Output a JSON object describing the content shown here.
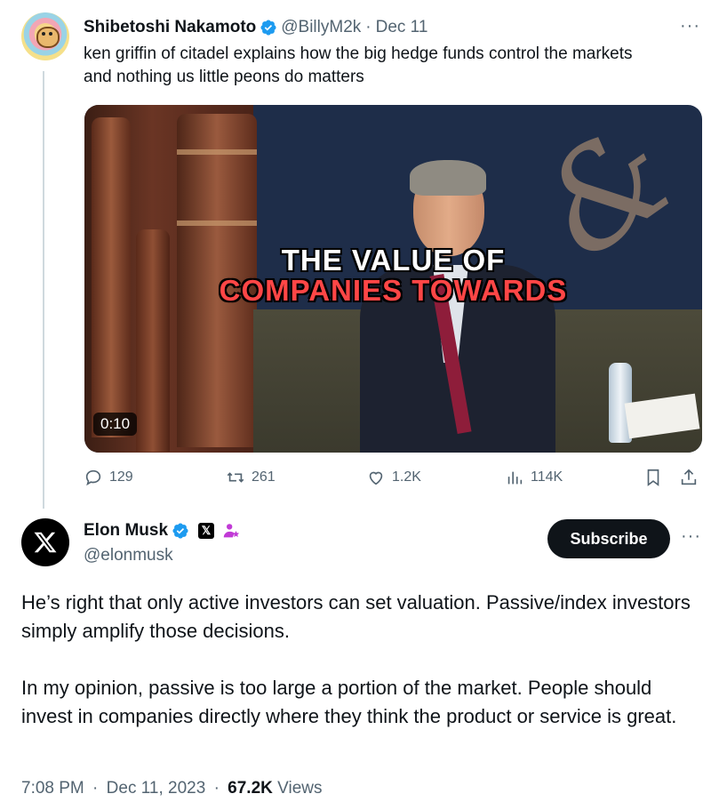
{
  "quoted_tweet": {
    "author_name": "Shibetoshi Nakamoto",
    "handle": "@BillyM2k",
    "separator": "·",
    "date": "Dec 11",
    "more": "···",
    "text_line1": "ken griffin of citadel explains how the big hedge funds control the markets",
    "text_line2": "and nothing us little peons do matters",
    "video": {
      "caption_line1": "THE VALUE OF",
      "caption_line2": "COMPANIES TOWARDS",
      "duration": "0:10"
    },
    "actions": {
      "replies": "129",
      "reposts": "261",
      "likes": "1.2K",
      "views": "114K"
    }
  },
  "main_tweet": {
    "author_name": "Elon Musk",
    "handle": "@elonmusk",
    "x_badge": "𝕏",
    "subscribe_label": "Subscribe",
    "more": "···",
    "paragraph1": "He’s right that only active investors can set valuation. Passive/index investors simply amplify those decisions.",
    "paragraph2": "In my opinion, passive is too large a portion of the market. People should invest in companies directly where they think the product or service is great.",
    "time": "7:08 PM",
    "date": "Dec 11, 2023",
    "separator": "·",
    "views_count": "67.2K",
    "views_label": "Views"
  },
  "colors": {
    "verified_blue": "#1d9bf0",
    "muted_text": "#536471",
    "affiliate_purple": "#c13ad6",
    "caption_red": "#ff4646"
  },
  "icons": [
    "verified-badge-icon",
    "reply-icon",
    "repost-icon",
    "like-icon",
    "views-icon",
    "bookmark-icon",
    "share-icon",
    "x-logo-icon",
    "affiliate-icon"
  ]
}
